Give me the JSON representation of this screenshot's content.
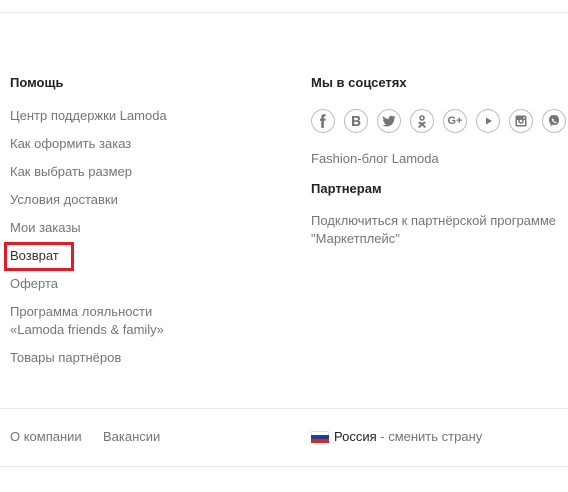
{
  "help": {
    "title": "Помощь",
    "links": [
      "Центр поддержки Lamoda",
      "Как оформить заказ",
      "Как выбрать размер",
      "Условия доставки",
      "Мои заказы",
      "Возврат",
      "Оферта",
      "Программа лояльности",
      "«Lamoda friends & family»",
      "Товары партнёров"
    ]
  },
  "social": {
    "title": "Мы в соцсетях",
    "icons": [
      "facebook-icon",
      "vk-icon",
      "twitter-icon",
      "odnoklassniki-icon",
      "google-plus-icon",
      "youtube-icon",
      "instagram-icon",
      "viber-icon"
    ],
    "blog_link": "Fashion-блог Lamoda"
  },
  "partners": {
    "title": "Партнерам",
    "link_line1": "Подключиться к партнёрской программе",
    "link_line2": "\"Маркетплейс\""
  },
  "footer": {
    "about": "О компании",
    "jobs": "Вакансии",
    "country": "Россия",
    "separator": " - ",
    "change_country": "сменить страну"
  },
  "colors": {
    "highlight": "#e21c24",
    "link": "#757575",
    "heading": "#222222"
  }
}
